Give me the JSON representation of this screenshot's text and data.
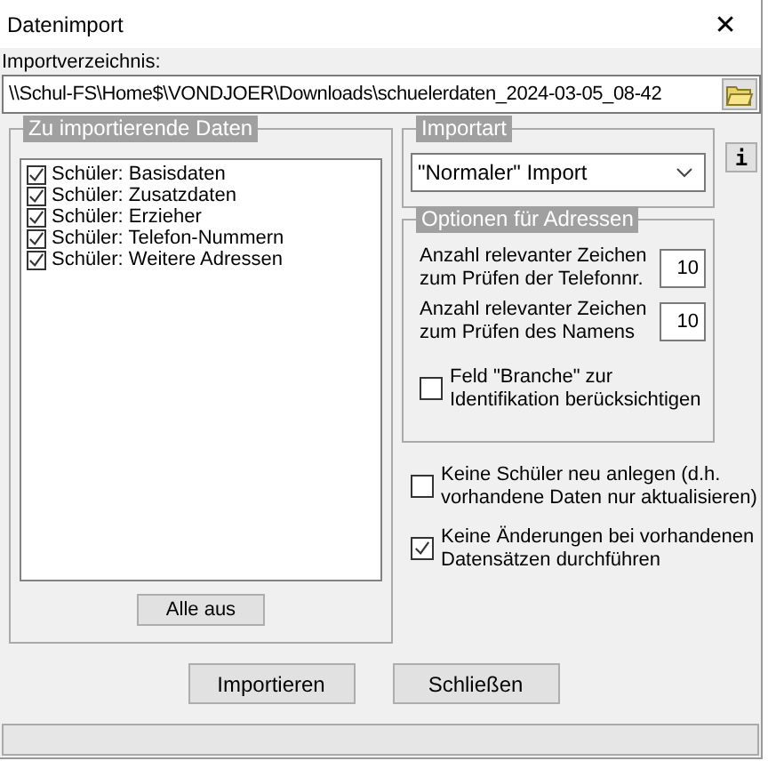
{
  "window": {
    "title": "Datenimport",
    "close": "✕"
  },
  "import_dir": {
    "label": "Importverzeichnis:",
    "value": "\\\\Schul-FS\\Home$\\VONDJOER\\Downloads\\schuelerdaten_2024-03-05_08-42"
  },
  "data_group": {
    "legend": "Zu importierende Daten",
    "items": [
      {
        "label": "Schüler: Basisdaten",
        "checked": true
      },
      {
        "label": "Schüler: Zusatzdaten",
        "checked": true
      },
      {
        "label": "Schüler: Erzieher",
        "checked": true
      },
      {
        "label": "Schüler: Telefon-Nummern",
        "checked": true
      },
      {
        "label": "Schüler: Weitere Adressen",
        "checked": true
      }
    ],
    "button": "Alle aus"
  },
  "import_type": {
    "legend": "Importart",
    "value": "\"Normaler\" Import",
    "info": "i"
  },
  "address_options": {
    "legend": "Optionen für Adressen",
    "fields": [
      {
        "label": "Anzahl relevanter Zeichen zum Prüfen der Telefonnr.",
        "value": "10"
      },
      {
        "label": "Anzahl relevanter Zeichen zum Prüfen des Namens",
        "value": "10"
      }
    ],
    "checkbox": {
      "label": "Feld \"Branche\" zur Identifikation berücksichtigen",
      "checked": false
    }
  },
  "options": [
    {
      "label": "Keine Schüler neu anlegen (d.h. vorhandene Daten nur aktualisieren)",
      "checked": false
    },
    {
      "label": "Keine Änderungen bei vorhandenen Datensätzen durchführen",
      "checked": true
    }
  ],
  "buttons": [
    "Importieren",
    "Schließen"
  ]
}
